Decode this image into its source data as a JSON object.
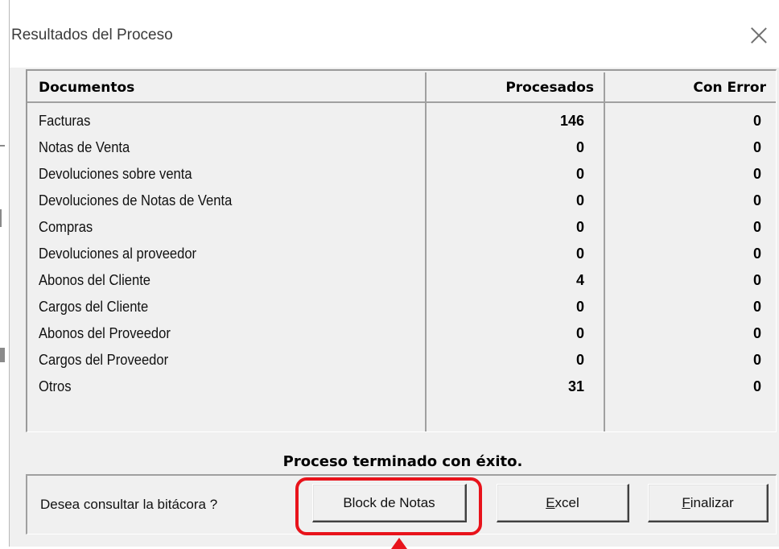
{
  "window": {
    "title": "Resultados del Proceso"
  },
  "table": {
    "headers": {
      "documents": "Documentos",
      "processed": "Procesados",
      "errors": "Con Error"
    },
    "rows": [
      {
        "document": "Facturas",
        "processed": "146",
        "errors": "0"
      },
      {
        "document": "Notas de Venta",
        "processed": "0",
        "errors": "0"
      },
      {
        "document": "Devoluciones sobre venta",
        "processed": "0",
        "errors": "0"
      },
      {
        "document": "Devoluciones de Notas de Venta",
        "processed": "0",
        "errors": "0"
      },
      {
        "document": "Compras",
        "processed": "0",
        "errors": "0"
      },
      {
        "document": "Devoluciones al proveedor",
        "processed": "0",
        "errors": "0"
      },
      {
        "document": "Abonos del Cliente",
        "processed": "4",
        "errors": "0"
      },
      {
        "document": "Cargos del Cliente",
        "processed": "0",
        "errors": "0"
      },
      {
        "document": "Abonos del Proveedor",
        "processed": "0",
        "errors": "0"
      },
      {
        "document": "Cargos del Proveedor",
        "processed": "0",
        "errors": "0"
      },
      {
        "document": "Otros",
        "processed": "31",
        "errors": "0"
      }
    ]
  },
  "status": "Proceso terminado con éxito.",
  "footer": {
    "prompt": "Desea consultar la bitácora ?",
    "buttons": {
      "notepad": "Block de Notas",
      "excel_accel": "E",
      "excel_rest": "xcel",
      "finish_accel": "F",
      "finish_rest": "inalizar"
    }
  },
  "annotation": {
    "color": "#e8131b"
  },
  "icons": {
    "close": "close-icon"
  }
}
